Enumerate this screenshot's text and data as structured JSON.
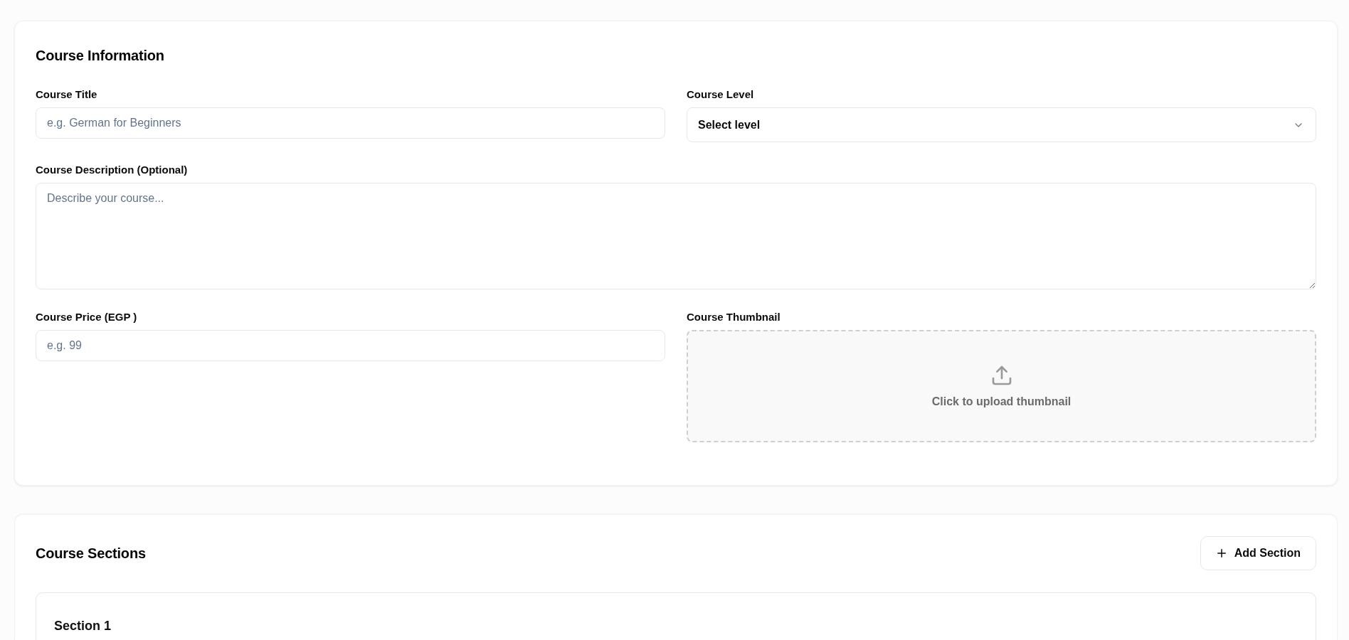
{
  "course_information": {
    "title": "Course Information",
    "rows": [
      [
        {
          "kind": "text",
          "label": "Course Title",
          "placeholder": "e.g. German for Beginners"
        },
        {
          "kind": "select",
          "label": "Course Level",
          "value": "Select level"
        }
      ],
      [
        {
          "kind": "textarea",
          "label": "Course Description (Optional)",
          "placeholder": "Describe your course..."
        }
      ],
      [
        {
          "kind": "text",
          "label": "Course Price (EGP )",
          "placeholder": "e.g. 99"
        },
        {
          "kind": "upload",
          "label": "Course Thumbnail",
          "prompt": "Click to upload thumbnail"
        }
      ]
    ]
  },
  "course_sections": {
    "title": "Course Sections",
    "add_button": "Add Section",
    "sections": [
      {
        "title": "Section 1"
      }
    ]
  }
}
